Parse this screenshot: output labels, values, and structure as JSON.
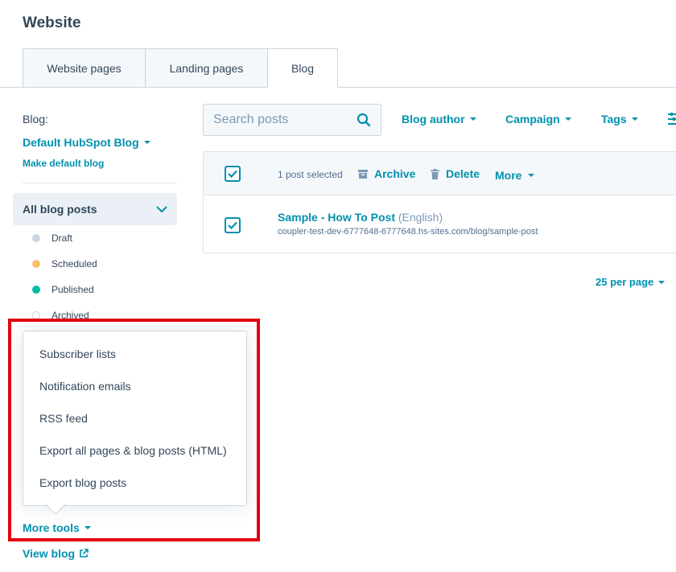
{
  "header": {
    "title": "Website"
  },
  "tabs": [
    {
      "label": "Website pages",
      "active": false
    },
    {
      "label": "Landing pages",
      "active": false
    },
    {
      "label": "Blog",
      "active": true
    }
  ],
  "sidebar": {
    "blog_label": "Blog:",
    "blog_select": "Default HubSpot Blog",
    "make_default": "Make default blog",
    "all_posts": "All blog posts",
    "statuses": [
      {
        "label": "Draft",
        "color": "#cbd6e2"
      },
      {
        "label": "Scheduled",
        "color": "#f5c26b"
      },
      {
        "label": "Published",
        "color": "#00bda5"
      },
      {
        "label": "Archived",
        "color": "#ffffff"
      }
    ]
  },
  "filters": {
    "search_placeholder": "Search posts",
    "blog_author": "Blog author",
    "campaign": "Campaign",
    "tags": "Tags"
  },
  "table": {
    "selected_text": "1 post selected",
    "archive": "Archive",
    "delete": "Delete",
    "more": "More",
    "rows": [
      {
        "title": "Sample - How To Post",
        "language": "(English)",
        "url": "coupler-test-dev-6777648-6777648.hs-sites.com/blog/sample-post",
        "checked": true
      }
    ]
  },
  "pagination": {
    "per_page": "25 per page"
  },
  "more_tools_menu": {
    "items": [
      "Subscriber lists",
      "Notification emails",
      "RSS feed",
      "Export all pages & blog posts (HTML)",
      "Export blog posts"
    ],
    "toggle_label": "More tools"
  },
  "footer_links": {
    "view_blog": "View blog"
  },
  "colors": {
    "accent": "#0091ae",
    "text": "#33475b",
    "highlight": "#e3000f"
  }
}
